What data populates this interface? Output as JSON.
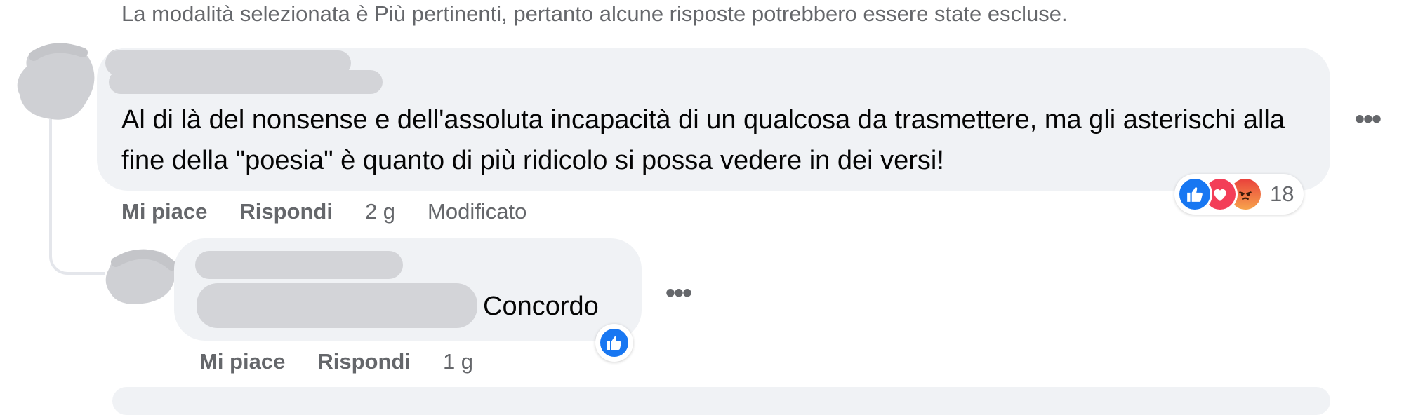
{
  "notice": "La modalità selezionata è Più pertinenti, pertanto alcune risposte potrebbero essere state escluse.",
  "comment": {
    "text": "Al di là del nonsense e dell'assoluta incapacità di un qualcosa da trasmettere, ma gli asterischi alla fine della \"poesia\" è quanto di più ridicolo si possa vedere in dei versi!",
    "actions": {
      "like": "Mi piace",
      "reply": "Rispondi",
      "time": "2 g",
      "edited": "Modificato"
    },
    "reactions": {
      "icons": [
        "like-icon",
        "love-icon",
        "angry-icon"
      ],
      "count": "18"
    },
    "more": "•••"
  },
  "reply": {
    "text": "Concordo",
    "actions": {
      "like": "Mi piace",
      "reply": "Rispondi",
      "time": "1 g"
    },
    "reactions": {
      "icons": [
        "like-icon"
      ]
    },
    "more": "•••"
  },
  "colors": {
    "like_blue": "#1877f2",
    "love_red": "#f33e58",
    "angry_orange": "#f7714c",
    "bubble_bg": "#f0f2f5",
    "meta_gray": "#65676b"
  }
}
